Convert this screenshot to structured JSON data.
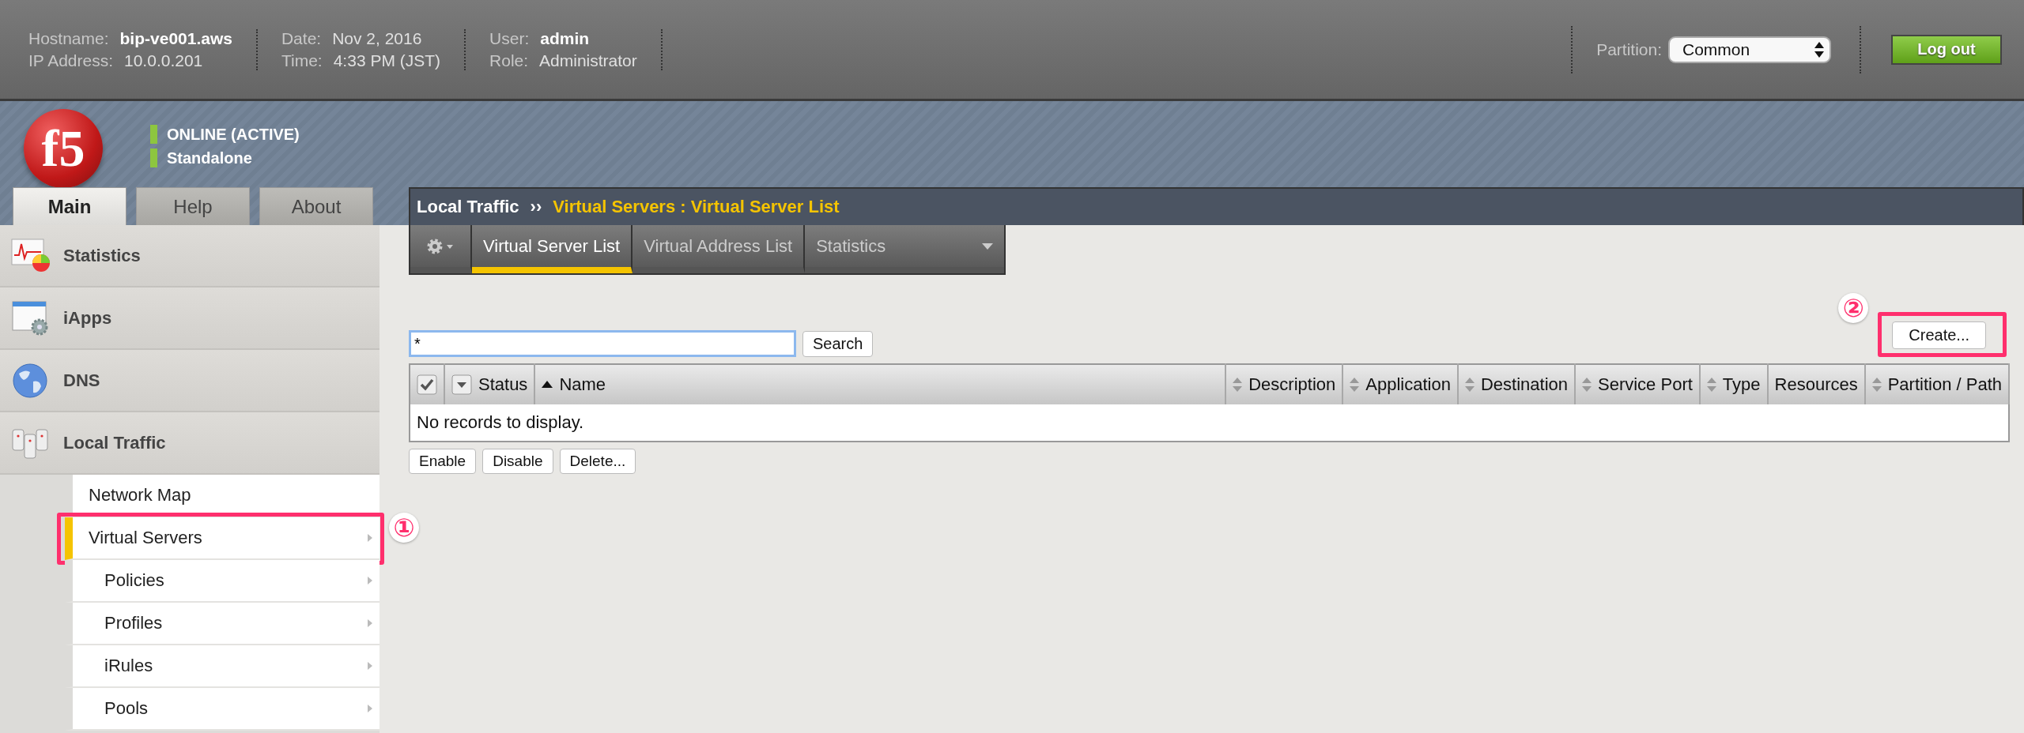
{
  "header": {
    "info_groups": [
      {
        "fields": [
          {
            "label": "Hostname:",
            "value": "bip-ve001.aws",
            "bold": true
          },
          {
            "label": "IP Address:",
            "value": "10.0.0.201",
            "bold": false
          }
        ]
      },
      {
        "fields": [
          {
            "label": "Date:",
            "value": "Nov 2, 2016",
            "bold": false
          },
          {
            "label": "Time:",
            "value": "4:33 PM (JST)",
            "bold": false
          }
        ]
      },
      {
        "fields": [
          {
            "label": "User:",
            "value": "admin",
            "bold": true
          },
          {
            "label": "Role:",
            "value": "Administrator",
            "bold": false
          }
        ]
      }
    ],
    "partition": {
      "label": "Partition:",
      "value": "Common"
    },
    "logout_button": "Log out"
  },
  "banner": {
    "logo": "f5",
    "status": [
      "ONLINE (ACTIVE)",
      "Standalone"
    ]
  },
  "nav_tabs": [
    {
      "label": "Main",
      "selected": true
    },
    {
      "label": "Help",
      "selected": false
    },
    {
      "label": "About",
      "selected": false
    }
  ],
  "sidebar": {
    "sections": [
      {
        "kind": "statistics",
        "label": "Statistics"
      },
      {
        "kind": "iapps",
        "label": "iApps"
      },
      {
        "kind": "dns",
        "label": "DNS"
      },
      {
        "kind": "local-traffic",
        "label": "Local Traffic",
        "items": [
          {
            "kind": "primary",
            "label": "Network Map",
            "selected": false,
            "arrow": false
          },
          {
            "kind": "primary",
            "label": "Virtual Servers",
            "selected": true,
            "arrow": true,
            "annotation": "①"
          },
          {
            "kind": "secondary",
            "label": "Policies",
            "selected": false,
            "arrow": true
          },
          {
            "kind": "secondary",
            "label": "Profiles",
            "selected": false,
            "arrow": true
          },
          {
            "kind": "secondary",
            "label": "iRules",
            "selected": false,
            "arrow": true
          },
          {
            "kind": "secondary",
            "label": "Pools",
            "selected": false,
            "arrow": true
          }
        ]
      }
    ]
  },
  "breadcrumb": {
    "section": "Local Traffic",
    "separator": "››",
    "page": "Virtual Servers : Virtual Server List"
  },
  "subtabs": [
    {
      "label": "Virtual Server List",
      "selected": true,
      "dropdown": false
    },
    {
      "label": "Virtual Address List",
      "selected": false,
      "dropdown": false
    },
    {
      "label": "Statistics",
      "selected": false,
      "dropdown": true
    }
  ],
  "search": {
    "value": "*",
    "button": "Search"
  },
  "create_button": {
    "label": "Create...",
    "annotation": "②"
  },
  "table": {
    "columns": [
      {
        "kind": "checkbox"
      },
      {
        "kind": "filter",
        "label": "Status"
      },
      {
        "kind": "sort-asc",
        "label": "Name"
      },
      {
        "kind": "sort",
        "label": "Description"
      },
      {
        "kind": "sort",
        "label": "Application"
      },
      {
        "kind": "sort",
        "label": "Destination"
      },
      {
        "kind": "sort",
        "label": "Service Port"
      },
      {
        "kind": "sort",
        "label": "Type"
      },
      {
        "kind": "plain",
        "label": "Resources"
      },
      {
        "kind": "sort",
        "label": "Partition / Path"
      }
    ],
    "empty_message": "No records to display."
  },
  "actions": [
    "Enable",
    "Disable",
    "Delete..."
  ]
}
